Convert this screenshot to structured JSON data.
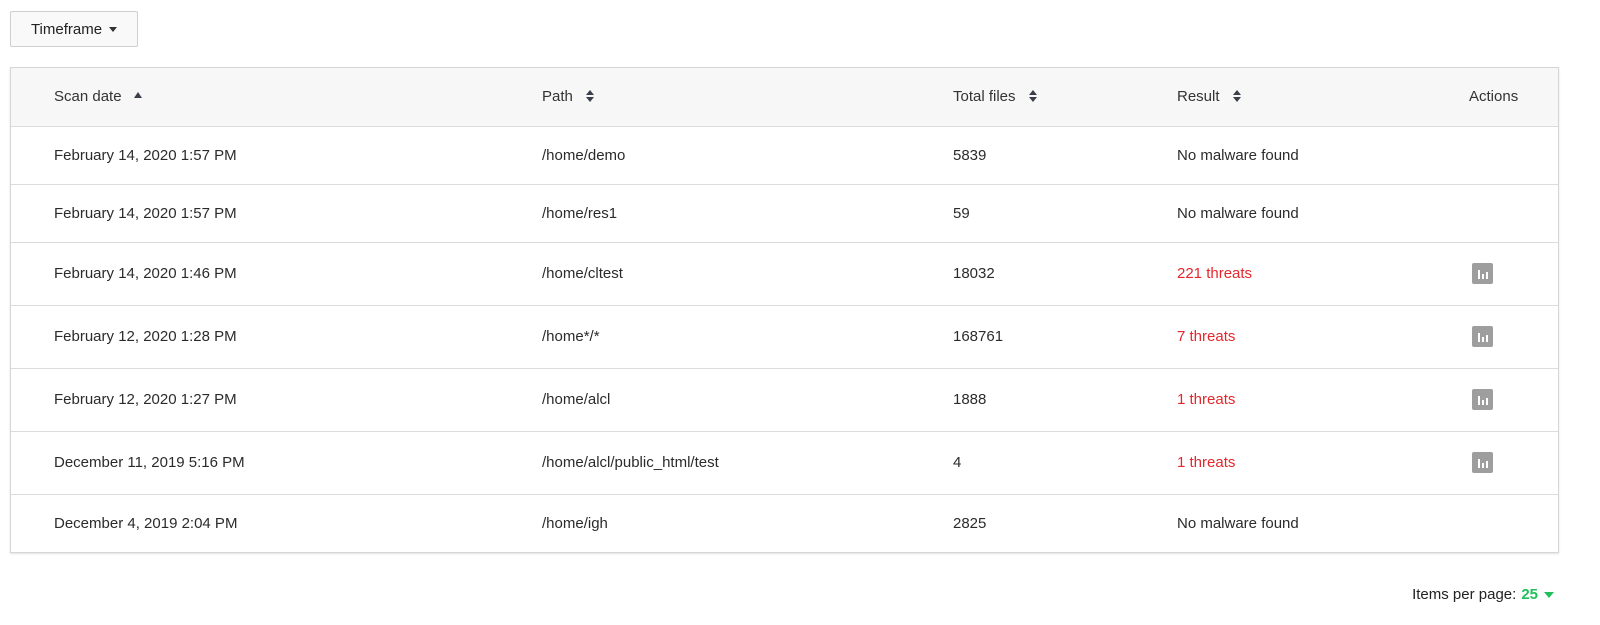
{
  "toolbar": {
    "timeframe_label": "Timeframe"
  },
  "table": {
    "columns": {
      "scan_date": "Scan date",
      "path": "Path",
      "total_files": "Total files",
      "result": "Result",
      "actions": "Actions"
    },
    "rows": [
      {
        "date": "February 14, 2020 1:57 PM",
        "path": "/home/demo",
        "files": "5839",
        "result": "No malware found",
        "threat": false
      },
      {
        "date": "February 14, 2020 1:57 PM",
        "path": "/home/res1",
        "files": "59",
        "result": "No malware found",
        "threat": false
      },
      {
        "date": "February 14, 2020 1:46 PM",
        "path": "/home/cltest",
        "files": "18032",
        "result": "221 threats",
        "threat": true
      },
      {
        "date": "February 12, 2020 1:28 PM",
        "path": "/home*/*",
        "files": "168761",
        "result": "7 threats",
        "threat": true
      },
      {
        "date": "February 12, 2020 1:27 PM",
        "path": "/home/alcl",
        "files": "1888",
        "result": "1 threats",
        "threat": true
      },
      {
        "date": "December 11, 2019 5:16 PM",
        "path": "/home/alcl/public_html/test",
        "files": "4",
        "result": "1 threats",
        "threat": true
      },
      {
        "date": "December 4, 2019 2:04 PM",
        "path": "/home/igh",
        "files": "2825",
        "result": "No malware found",
        "threat": false
      }
    ]
  },
  "pagination": {
    "label": "Items per page:",
    "value": "25"
  },
  "colors": {
    "threat": "#e5272c",
    "accent": "#1fbf5b"
  }
}
